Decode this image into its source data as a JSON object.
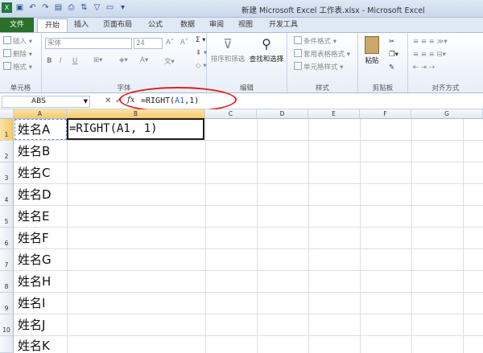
{
  "window": {
    "title": "新建 Microsoft Excel 工作表.xlsx - Microsoft Excel"
  },
  "tabs": [
    "文件",
    "开始",
    "插入",
    "页面布局",
    "公式",
    "数据",
    "审阅",
    "视图",
    "开发工具"
  ],
  "ribbon": {
    "cells": {
      "insert": "插入",
      "delete": "删除",
      "format": "格式",
      "label": "单元格"
    },
    "font": {
      "name": "宋体",
      "size": "24",
      "bold": "B",
      "italic": "I",
      "underline": "U",
      "label": "字体"
    },
    "editing": {
      "sort": "排序和筛选",
      "find": "查找和选择",
      "label": "编辑"
    },
    "styles": {
      "conditional": "条件格式",
      "table": "套用表格格式",
      "cell": "单元格样式",
      "label": "样式"
    },
    "clipboard": {
      "paste": "粘贴",
      "label": "剪贴板"
    },
    "align": {
      "label": "对齐方式"
    }
  },
  "formula_bar": {
    "name_box": "ABS",
    "cancel": "✕",
    "confirm": "✓",
    "fx": "fx",
    "formula_prefix": "=RIGHT(",
    "formula_ref": "A1",
    "formula_suffix": ",1)"
  },
  "columns": [
    "A",
    "B",
    "C",
    "D",
    "E",
    "F",
    "G"
  ],
  "rows": [
    {
      "num": "1",
      "a": "姓名A"
    },
    {
      "num": "2",
      "a": "姓名B"
    },
    {
      "num": "3",
      "a": "姓名C"
    },
    {
      "num": "4",
      "a": "姓名D"
    },
    {
      "num": "5",
      "a": "姓名E"
    },
    {
      "num": "6",
      "a": "姓名F"
    },
    {
      "num": "7",
      "a": "姓名G"
    },
    {
      "num": "8",
      "a": "姓名H"
    },
    {
      "num": "9",
      "a": "姓名I"
    },
    {
      "num": "10",
      "a": "姓名J"
    },
    {
      "num": "",
      "a": "姓名K"
    }
  ],
  "cell_b1": "=RIGHT(A1, 1)",
  "colors": {
    "file_tab": "#2a6f2a",
    "annotation": "#e0201b",
    "ref_blue": "#2d5dc8"
  }
}
